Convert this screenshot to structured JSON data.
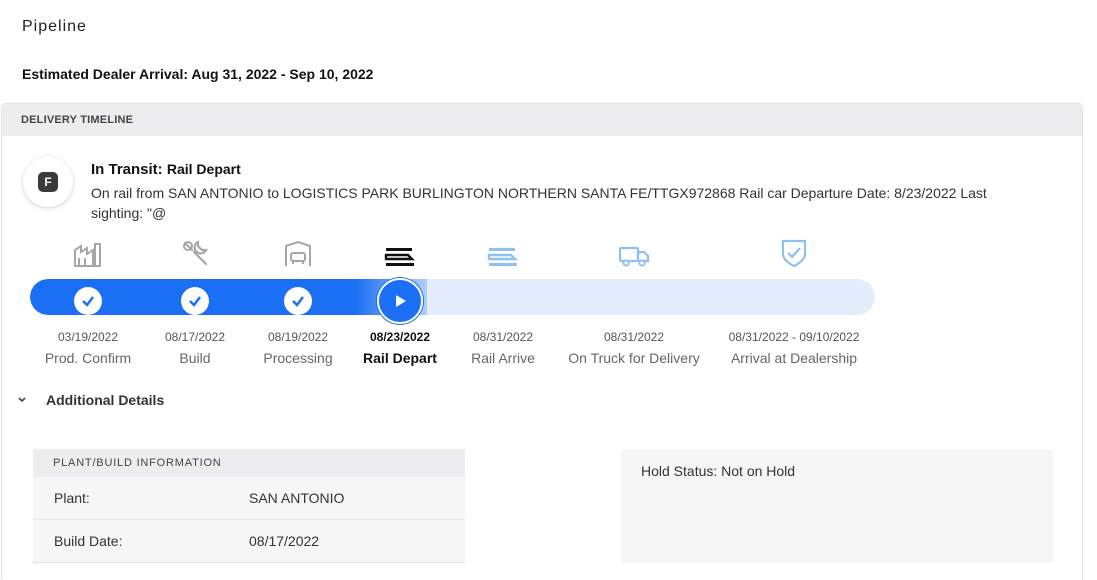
{
  "page": {
    "title": "Pipeline",
    "eta": "Estimated Dealer Arrival: Aug 31, 2022 - Sep 10, 2022"
  },
  "card": {
    "header": "DELIVERY TIMELINE",
    "status": {
      "icon": "ford-logo-icon",
      "icon_text": "F",
      "title": "In Transit:",
      "subtitle": "Rail Depart",
      "description": "On rail from SAN ANTONIO to LOGISTICS PARK BURLINGTON NORTHERN SANTA FE/TTGX972868 Rail car Departure Date: 8/23/2022 Last sighting: \"@"
    },
    "timeline": {
      "progress_fraction": 0.47,
      "steps": [
        {
          "date": "03/19/2022",
          "label": "Prod. Confirm",
          "state": "done",
          "icon": "factory-icon"
        },
        {
          "date": "08/17/2022",
          "label": "Build",
          "state": "done",
          "icon": "wrench-icon"
        },
        {
          "date": "08/19/2022",
          "label": "Processing",
          "state": "done",
          "icon": "vehicle-processing-icon"
        },
        {
          "date": "08/23/2022",
          "label": "Rail Depart",
          "state": "current",
          "icon": "rail-car-icon"
        },
        {
          "date": "08/31/2022",
          "label": "Rail Arrive",
          "state": "pending",
          "icon": "rail-car-icon"
        },
        {
          "date": "08/31/2022",
          "label": "On Truck for Delivery",
          "state": "pending",
          "icon": "truck-icon"
        },
        {
          "date": "08/31/2022 - 09/10/2022",
          "label": "Arrival at Dealership",
          "state": "pending",
          "icon": "shield-check-icon"
        }
      ]
    },
    "additional_details": {
      "label": "Additional Details",
      "plant_info": {
        "header": "PLANT/BUILD INFORMATION",
        "rows": [
          {
            "key": "Plant:",
            "value": "SAN ANTONIO"
          },
          {
            "key": "Build Date:",
            "value": "08/17/2022"
          }
        ]
      },
      "hold_status": "Hold Status: Not on Hold"
    }
  },
  "colors": {
    "accent": "#1a6ff4",
    "track_bg": "#e3edfc",
    "done_icon": "#8a8a8e",
    "current_icon": "#111111",
    "pending_icon": "#8ec0f0"
  }
}
